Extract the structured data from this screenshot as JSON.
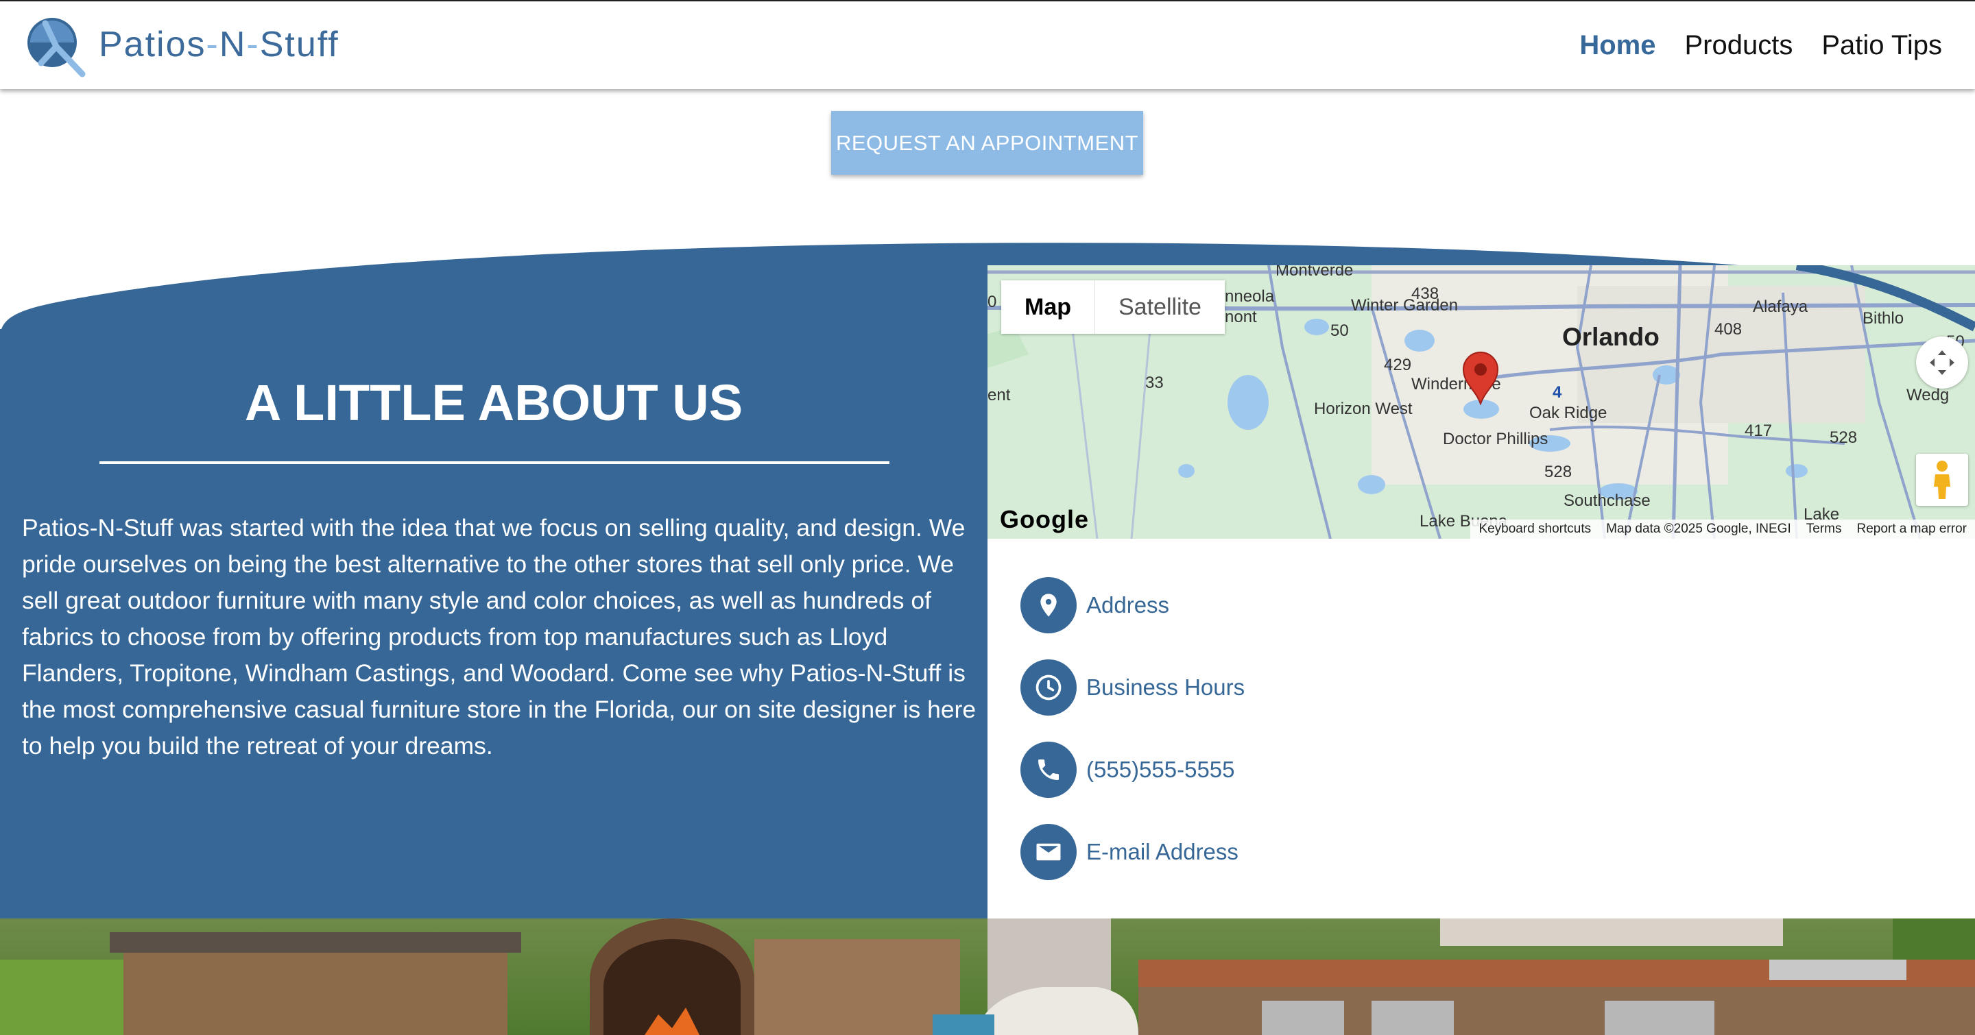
{
  "header": {
    "brand": {
      "part1": "Patios",
      "dash1": "-",
      "part2": "N",
      "dash2": "-",
      "part3": "Stuff"
    },
    "nav": [
      {
        "label": "Home",
        "active": true
      },
      {
        "label": "Products",
        "active": false
      },
      {
        "label": "Patio Tips",
        "active": false
      }
    ]
  },
  "cta": {
    "label": "REQUEST AN APPOINTMENT"
  },
  "about": {
    "title": "A LITTLE ABOUT US",
    "body": "Patios-N-Stuff was started with the idea that we focus on selling quality, and design. We pride ourselves on being the best alternative to the other stores that sell only price. We sell great outdoor furniture with many style and color choices, as well as hundreds of fabrics to choose from by offering products from top manufactures such as Lloyd Flanders, Tropitone, Windham Castings, and Woodard. Come see why Patios-N-Stuff is the most comprehensive casual furniture store in the Florida, our on site designer is here to help you build the retreat of your dreams."
  },
  "map": {
    "tabs": [
      "Map",
      "Satellite"
    ],
    "labels": {
      "orlando": "Orlando",
      "winter_garden": "Winter Garden",
      "montverde": "Montverde",
      "alafaya": "Alafaya",
      "bithlo": "Bithlo",
      "horizon_west": "Horizon West",
      "windermere": "Windermere",
      "oak_ridge": "Oak Ridge",
      "doctor_phillips": "Doctor Phillips",
      "southchase": "Southchase",
      "lake_buena": "Lake Buena",
      "wedgefield": "Wedg",
      "lake": "Lake",
      "clermont_fragment": "nont",
      "minneola_fragment": "nneola",
      "left_fragment": "ent"
    },
    "shields": [
      "438",
      "50",
      "429",
      "408",
      "33",
      "4",
      "417",
      "528",
      "528",
      "50",
      "0"
    ],
    "google": "Google",
    "footer": [
      "Keyboard shortcuts",
      "Map data ©2025 Google, INEGI",
      "Terms",
      "Report a map error"
    ]
  },
  "contact": [
    {
      "icon": "location-pin-icon",
      "label": "Address"
    },
    {
      "icon": "clock-icon",
      "label": "Business Hours"
    },
    {
      "icon": "phone-icon",
      "label": "(555)555-5555"
    },
    {
      "icon": "mail-icon",
      "label": "E-mail Address"
    }
  ],
  "colors": {
    "brand_blue": "#366796",
    "cta_blue": "#8ebbe6",
    "nav_active": "#36689a"
  }
}
